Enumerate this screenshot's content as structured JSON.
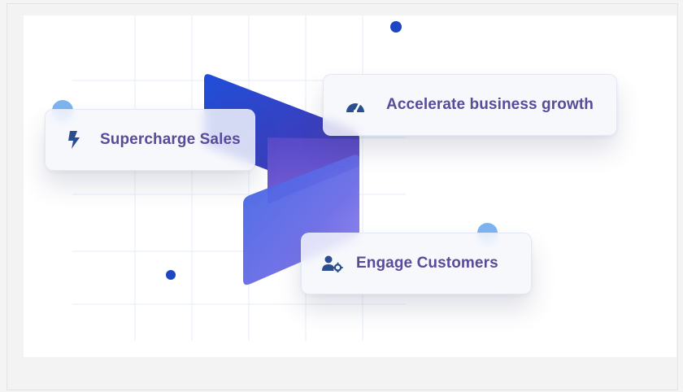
{
  "cards": {
    "sales": {
      "label": "Supercharge Sales",
      "icon": "lightning-bolt-icon"
    },
    "growth": {
      "label": "Accelerate business growth",
      "icon": "speedometer-icon"
    },
    "engage": {
      "label": "Engage Customers",
      "icon": "user-gear-icon"
    }
  },
  "colors": {
    "accent_dark": "#1d46c4",
    "accent_light": "#7db4ef",
    "label_text": "#5a4a9a",
    "icon": "#2a4e8f"
  }
}
